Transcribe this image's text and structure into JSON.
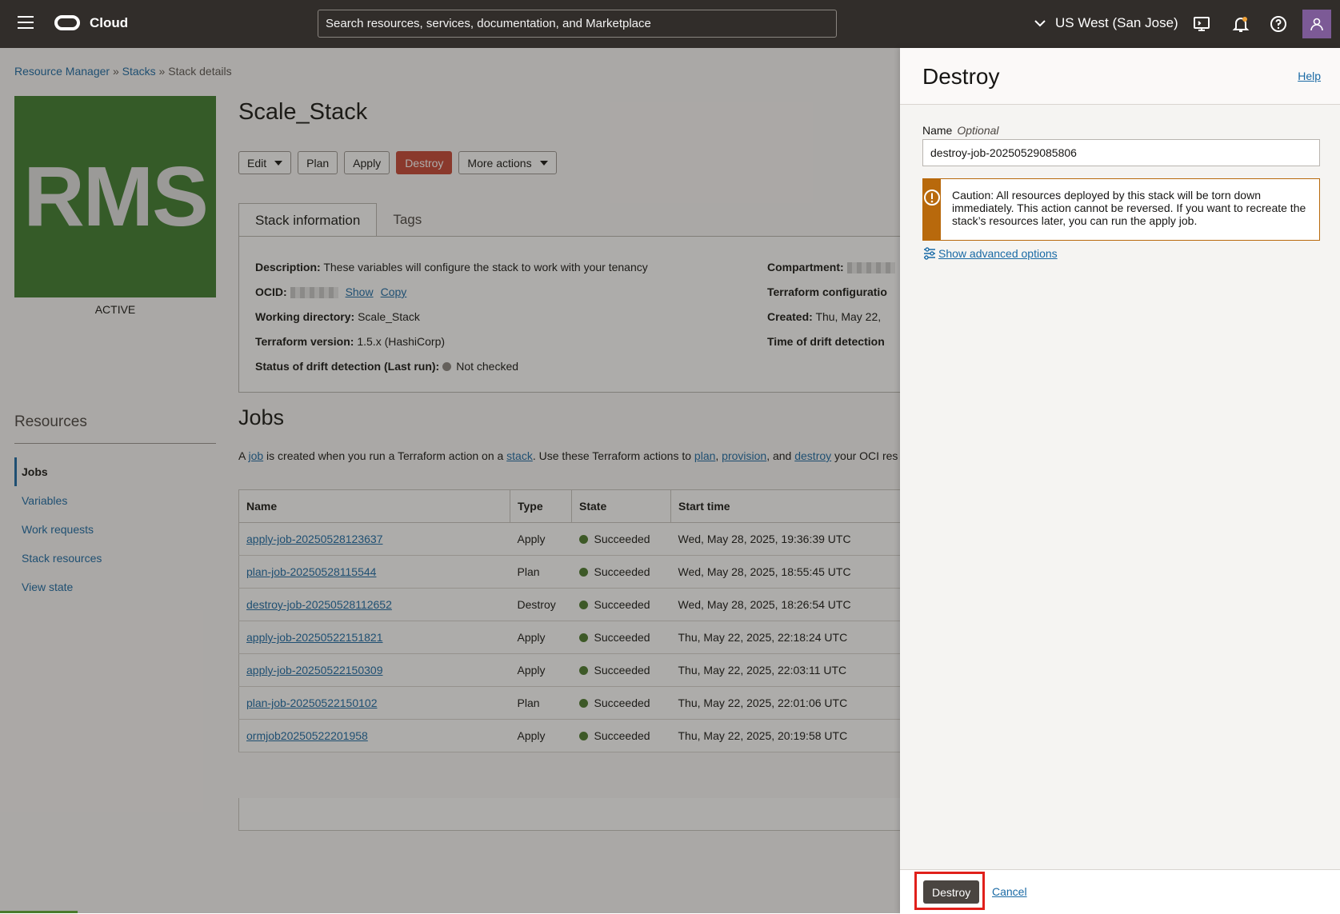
{
  "header": {
    "brand": "Cloud",
    "search_placeholder": "Search resources, services, documentation, and Marketplace",
    "region": "US West (San Jose)"
  },
  "breadcrumb": {
    "item1": "Resource Manager",
    "item2": "Stacks",
    "current": "Stack details",
    "sep": "»"
  },
  "tile": {
    "text": "RMS",
    "status": "ACTIVE",
    "color": "#3e7d2e"
  },
  "resources": {
    "title": "Resources",
    "items": [
      "Jobs",
      "Variables",
      "Work requests",
      "Stack resources",
      "View state"
    ]
  },
  "stack": {
    "title": "Scale_Stack"
  },
  "actions": {
    "edit": "Edit",
    "plan": "Plan",
    "apply": "Apply",
    "destroy": "Destroy",
    "more": "More actions"
  },
  "tabs": [
    "Stack information",
    "Tags"
  ],
  "info": {
    "description_label": "Description:",
    "description": "These variables will configure the stack to work with your tenancy",
    "ocid_label": "OCID:",
    "show": "Show",
    "copy": "Copy",
    "workdir_label": "Working directory:",
    "workdir": "Scale_Stack",
    "tfver_label": "Terraform version:",
    "tfver": "1.5.x (HashiCorp)",
    "drift_label": "Status of drift detection (Last run):",
    "drift": "Not checked",
    "compartment_label": "Compartment:",
    "tfconfig_label": "Terraform configuratio",
    "created_label": "Created:",
    "created": "Thu, May 22,",
    "drifttime_label": "Time of drift detection"
  },
  "jobs": {
    "title": "Jobs",
    "desc": {
      "p1": "A ",
      "l1": "job",
      "p2": " is created when you run a Terraform action on a ",
      "l2": "stack",
      "p3": ". Use these Terraform actions to ",
      "l3": "plan",
      "p4": ", ",
      "l4": "provision",
      "p5": ", and ",
      "l5": "destroy",
      "p6": " your OCI res"
    },
    "columns": [
      "Name",
      "Type",
      "State",
      "Start time"
    ],
    "rows": [
      {
        "name": "apply-job-20250528123637",
        "type": "Apply",
        "state": "Succeeded",
        "start": "Wed, May 28, 2025, 19:36:39 UTC"
      },
      {
        "name": "plan-job-20250528115544",
        "type": "Plan",
        "state": "Succeeded",
        "start": "Wed, May 28, 2025, 18:55:45 UTC"
      },
      {
        "name": "destroy-job-20250528112652",
        "type": "Destroy",
        "state": "Succeeded",
        "start": "Wed, May 28, 2025, 18:26:54 UTC"
      },
      {
        "name": "apply-job-20250522151821",
        "type": "Apply",
        "state": "Succeeded",
        "start": "Thu, May 22, 2025, 22:18:24 UTC"
      },
      {
        "name": "apply-job-20250522150309",
        "type": "Apply",
        "state": "Succeeded",
        "start": "Thu, May 22, 2025, 22:03:11 UTC"
      },
      {
        "name": "plan-job-20250522150102",
        "type": "Plan",
        "state": "Succeeded",
        "start": "Thu, May 22, 2025, 22:01:06 UTC"
      },
      {
        "name": "ormjob20250522201958",
        "type": "Apply",
        "state": "Succeeded",
        "start": "Thu, May 22, 2025, 20:19:58 UTC"
      }
    ]
  },
  "panel": {
    "title": "Destroy",
    "help": "Help",
    "name_label": "Name",
    "name_optional": "Optional",
    "name_value": "destroy-job-20250529085806",
    "caution": "Caution: All resources deployed by this stack will be torn down immediately. This action cannot be reversed. If you want to recreate the stack’s resources later, you can run the apply job.",
    "advanced": "Show advanced options",
    "confirm": "Destroy",
    "cancel": "Cancel",
    "caution_color": "#b8690c"
  }
}
